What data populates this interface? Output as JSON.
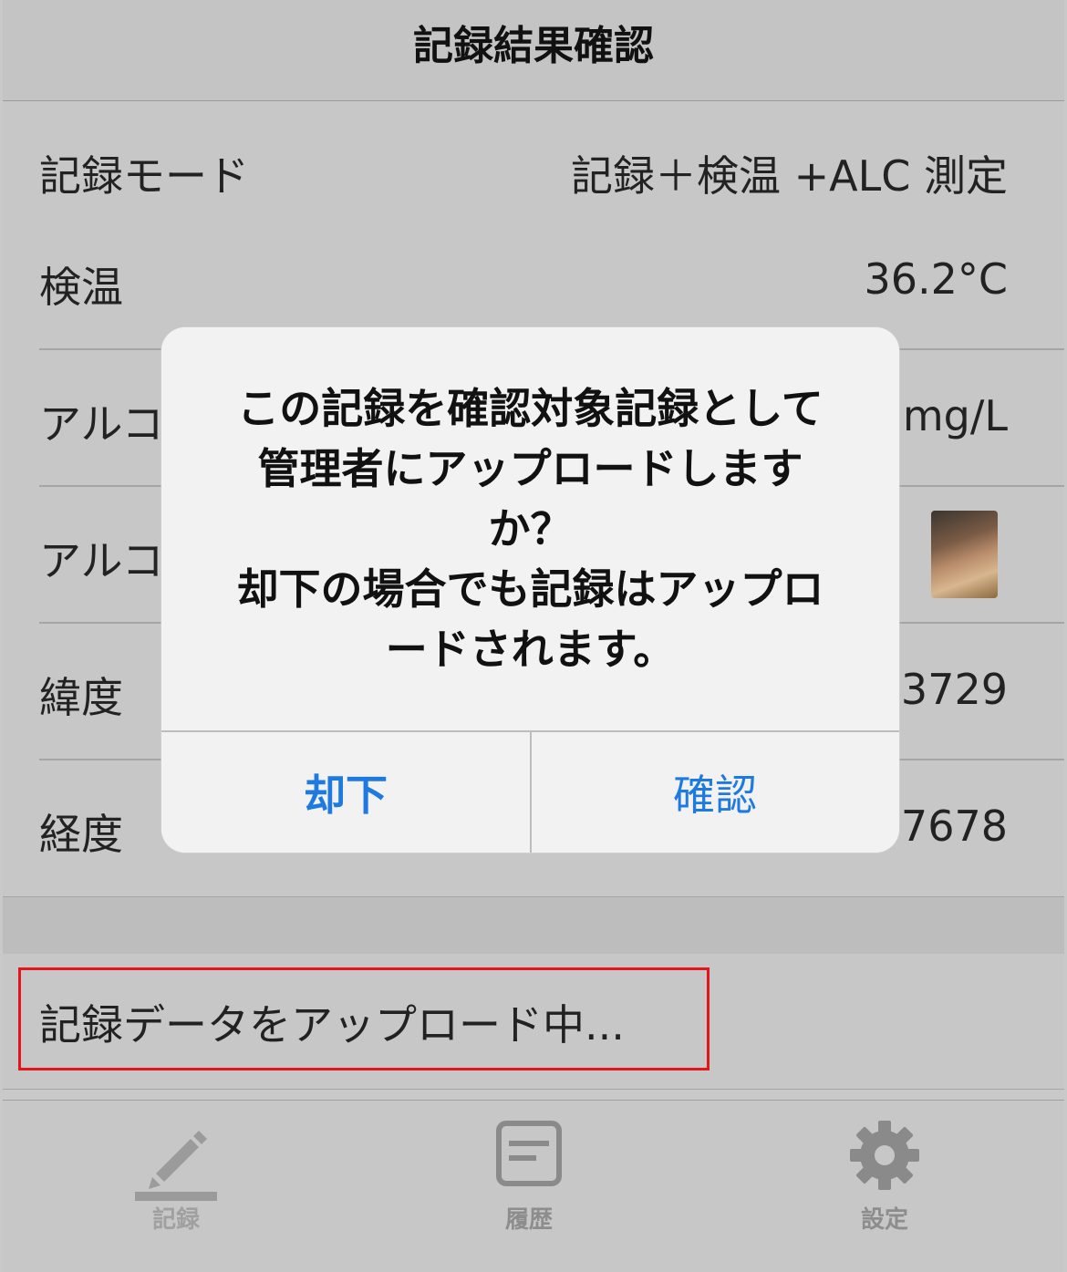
{
  "header": {
    "title": "記録結果確認"
  },
  "rows": [
    {
      "label": "記録モード",
      "value": "記録＋検温 +ALC 測定"
    },
    {
      "label": "検温",
      "value": "36.2°C"
    },
    {
      "label": "アルコ",
      "value": "mg/L"
    },
    {
      "label": "アルコ",
      "value": ""
    },
    {
      "label": "緯度",
      "value": "3729"
    },
    {
      "label": "経度",
      "value": "7678"
    }
  ],
  "upload_status": "記録データをアップロード中...",
  "alert": {
    "message": "この記録を確認対象記録として\n管理者にアップロードします\nか？\n却下の場合でも記録はアップロ\nードされます。",
    "reject_label": "却下",
    "confirm_label": "確認"
  },
  "tabs": [
    {
      "label": "記録",
      "icon": "pencil-icon"
    },
    {
      "label": "履歴",
      "icon": "document-icon"
    },
    {
      "label": "設定",
      "icon": "gear-icon"
    }
  ],
  "colors": {
    "accent": "#1f7ae0",
    "highlight_border": "#e3161b",
    "background": "#c9c9c9"
  }
}
